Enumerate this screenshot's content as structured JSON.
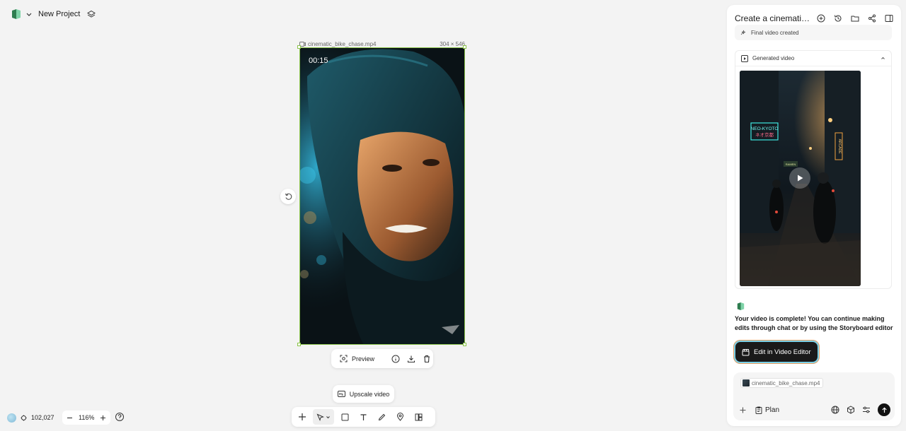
{
  "header": {
    "project_title": "New Project"
  },
  "canvas": {
    "file_name": "cinematic_bike_chase.mp4",
    "dimensions": "304 × 546",
    "timecode": "00:15",
    "preview_label": "Preview",
    "upscale_label": "Upscale video"
  },
  "status": {
    "credits": "102,027",
    "zoom": "116%"
  },
  "chat": {
    "title": "Create a cinematic bike chase video",
    "step_label": "Final video created",
    "generated_label": "Generated video",
    "thumbnail_signs": {
      "neon_main": "NEO-KYOTO",
      "neon_sub": "ネオ京都",
      "vertical": "ARCADE",
      "small": "RAMEN"
    },
    "message": "Your video is complete! You can continue making edits through chat or by using the Storyboard editor",
    "edit_button": "Edit in Video Editor",
    "attachment": "cinematic_bike_chase.mp4",
    "mode_label": "Plan"
  },
  "colors": {
    "selection": "#8bc34a",
    "panel_bg": "#ffffff",
    "canvas_bg": "#f3f3f3",
    "dark_button": "#1a1a1a"
  },
  "icons": [
    "logo-icon",
    "chevron-down-icon",
    "layers-icon",
    "video-file-icon",
    "rotate-icon",
    "preview-icon",
    "info-icon",
    "download-icon",
    "trash-icon",
    "upscale-icon",
    "plus-icon",
    "cursor-icon",
    "rectangle-icon",
    "text-icon",
    "pen-icon",
    "pin-icon",
    "storyboard-icon",
    "credit-icon",
    "zoom-out-icon",
    "zoom-in-icon",
    "help-icon",
    "new-chat-icon",
    "history-icon",
    "folder-icon",
    "share-icon",
    "sidebar-icon",
    "sparkle-icon",
    "video-icon",
    "chevron-up-icon",
    "clapper-icon",
    "globe-icon",
    "cube-icon",
    "sliders-icon",
    "send-icon"
  ]
}
